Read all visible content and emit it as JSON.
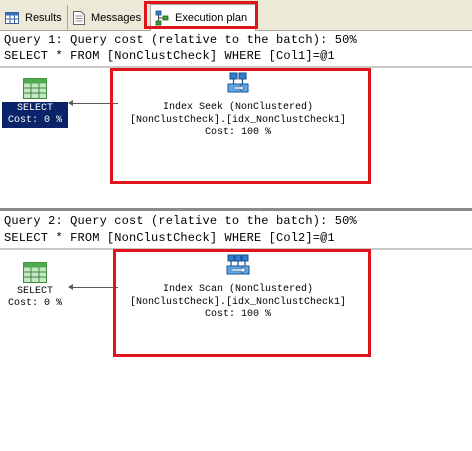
{
  "tabs": {
    "results": "Results",
    "messages": "Messages",
    "execution_plan": "Execution plan"
  },
  "queries": [
    {
      "cost_line": "Query 1: Query cost (relative to the batch): 50%",
      "sql_line": "SELECT * FROM [NonClustCheck] WHERE [Col1]=@1",
      "select_node": {
        "label": "SELECT",
        "cost": "Cost: 0 %"
      },
      "operator": {
        "name": "Index Seek (NonClustered)",
        "object": "[NonClustCheck].[idx_NonClustCheck1]",
        "cost": "Cost: 100 %"
      }
    },
    {
      "cost_line": "Query 2: Query cost (relative to the batch): 50%",
      "sql_line": "SELECT * FROM [NonClustCheck] WHERE [Col2]=@1",
      "select_node": {
        "label": "SELECT",
        "cost": "Cost: 0 %"
      },
      "operator": {
        "name": "Index Scan (NonClustered)",
        "object": "[NonClustCheck].[idx_NonClustCheck1]",
        "cost": "Cost: 100 %"
      }
    }
  ],
  "colors": {
    "highlight": "#e0151c",
    "selected_node": "#0a246a"
  }
}
